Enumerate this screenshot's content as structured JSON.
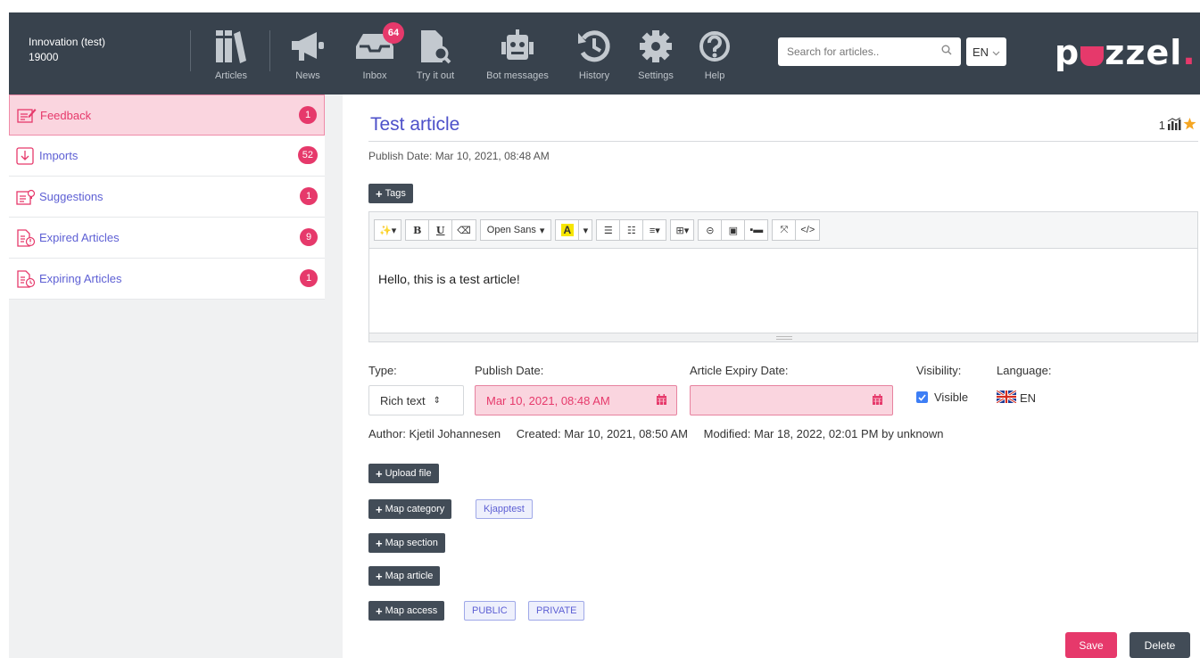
{
  "header": {
    "tenant_name": "Innovation (test)",
    "tenant_id": "19000",
    "nav": [
      {
        "label": "Articles",
        "icon": "books-icon"
      },
      {
        "label": "News",
        "icon": "megaphone-icon"
      },
      {
        "label": "Inbox",
        "icon": "inbox-icon",
        "badge": "64"
      },
      {
        "label": "Try it out",
        "icon": "document-search-icon"
      },
      {
        "label": "Bot messages",
        "icon": "robot-icon"
      },
      {
        "label": "History",
        "icon": "history-icon"
      },
      {
        "label": "Settings",
        "icon": "gear-icon"
      },
      {
        "label": "Help",
        "icon": "help-icon"
      }
    ],
    "search_placeholder": "Search for articles..",
    "language": "EN",
    "logo_text_1": "p",
    "logo_text_2": "zzel",
    "logo_dot": "."
  },
  "sidebar": {
    "items": [
      {
        "label": "Feedback",
        "count": "1",
        "icon": "feedback-icon",
        "active": true
      },
      {
        "label": "Imports",
        "count": "52",
        "icon": "import-icon"
      },
      {
        "label": "Suggestions",
        "count": "1",
        "icon": "suggestion-icon"
      },
      {
        "label": "Expired Articles",
        "count": "9",
        "icon": "expired-icon"
      },
      {
        "label": "Expiring Articles",
        "count": "1",
        "icon": "expiring-icon"
      }
    ]
  },
  "article": {
    "title": "Test article",
    "rating_count": "1",
    "publish_line": "Publish Date: Mar 10, 2021, 08:48 AM",
    "tags_button": "Tags",
    "editor": {
      "font_name": "Open Sans",
      "body": "Hello, this is a test article!"
    },
    "labels": {
      "type": "Type:",
      "publish_date": "Publish Date:",
      "expiry_date": "Article Expiry Date:",
      "visibility": "Visibility:",
      "language": "Language:"
    },
    "type_value": "Rich text",
    "publish_date_value": "Mar 10, 2021, 08:48 AM",
    "expiry_date_value": "",
    "visibility_value": "Visible",
    "language_value": "EN",
    "meta": {
      "author": "Author: Kjetil Johannesen",
      "created": "Created: Mar 10, 2021, 08:50 AM",
      "modified": "Modified: Mar 18, 2022, 02:01 PM by unknown"
    },
    "buttons": {
      "upload_file": "Upload file",
      "map_category": "Map category",
      "map_section": "Map section",
      "map_article": "Map article",
      "map_access": "Map access",
      "save": "Save",
      "delete": "Delete"
    },
    "category_chip": "Kjapptest",
    "access_chips": [
      "PUBLIC",
      "PRIVATE"
    ]
  },
  "colors": {
    "header_bg": "#38424d",
    "accent_pink": "#e6396b",
    "link_blue": "#5d5fd4",
    "button_dark": "#424c57"
  }
}
